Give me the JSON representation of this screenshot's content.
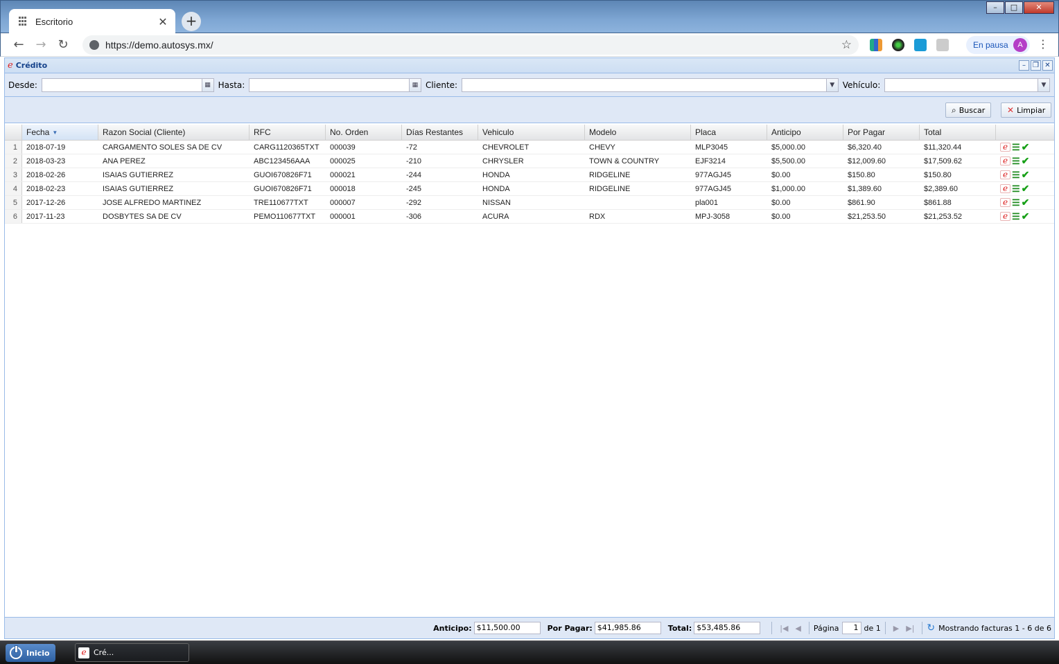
{
  "browser": {
    "tab_title": "Escritorio",
    "new_tab": "+",
    "url": "https://demo.autosys.mx/",
    "profile_status": "En pausa",
    "profile_initial": "A",
    "window_controls": {
      "minimize": "–",
      "maximize": "□",
      "close": "✕"
    }
  },
  "app": {
    "title": "Crédito",
    "logo_glyph": "e",
    "filters": {
      "desde_label": "Desde:",
      "desde_value": "",
      "hasta_label": "Hasta:",
      "hasta_value": "",
      "cliente_label": "Cliente:",
      "cliente_value": "",
      "vehiculo_label": "Vehículo:",
      "vehiculo_value": ""
    },
    "buttons": {
      "buscar": "Buscar",
      "limpiar": "Limpiar"
    },
    "grid": {
      "columns": [
        "Fecha",
        "Razon Social (Cliente)",
        "RFC",
        "No. Orden",
        "Días Restantes",
        "Vehiculo",
        "Modelo",
        "Placa",
        "Anticipo",
        "Por Pagar",
        "Total"
      ],
      "sort_indicator": "▼",
      "rows": [
        {
          "n": "1",
          "fecha": "2018-07-19",
          "razon": "CARGAMENTO SOLES SA DE CV",
          "rfc": "CARG1120365TXT",
          "orden": "000039",
          "dias": "-72",
          "vehiculo": "CHEVROLET",
          "modelo": "CHEVY",
          "placa": "MLP3045",
          "anticipo": "$5,000.00",
          "porpagar": "$6,320.40",
          "total": "$11,320.44"
        },
        {
          "n": "2",
          "fecha": "2018-03-23",
          "razon": "ANA PEREZ",
          "rfc": "ABC123456AAA",
          "orden": "000025",
          "dias": "-210",
          "vehiculo": "CHRYSLER",
          "modelo": "TOWN & COUNTRY",
          "placa": "EJF3214",
          "anticipo": "$5,500.00",
          "porpagar": "$12,009.60",
          "total": "$17,509.62"
        },
        {
          "n": "3",
          "fecha": "2018-02-26",
          "razon": "ISAIAS GUTIERREZ",
          "rfc": "GUOI670826F71",
          "orden": "000021",
          "dias": "-244",
          "vehiculo": "HONDA",
          "modelo": "RIDGELINE",
          "placa": "977AGJ45",
          "anticipo": "$0.00",
          "porpagar": "$150.80",
          "total": "$150.80"
        },
        {
          "n": "4",
          "fecha": "2018-02-23",
          "razon": "ISAIAS GUTIERREZ",
          "rfc": "GUOI670826F71",
          "orden": "000018",
          "dias": "-245",
          "vehiculo": "HONDA",
          "modelo": "RIDGELINE",
          "placa": "977AGJ45",
          "anticipo": "$1,000.00",
          "porpagar": "$1,389.60",
          "total": "$2,389.60"
        },
        {
          "n": "5",
          "fecha": "2017-12-26",
          "razon": "JOSE ALFREDO MARTINEZ",
          "rfc": "TRE110677TXT",
          "orden": "000007",
          "dias": "-292",
          "vehiculo": "NISSAN",
          "modelo": "",
          "placa": "pla001",
          "anticipo": "$0.00",
          "porpagar": "$861.90",
          "total": "$861.88"
        },
        {
          "n": "6",
          "fecha": "2017-11-23",
          "razon": "DOSBYTES SA DE CV",
          "rfc": "PEMO110677TXT",
          "orden": "000001",
          "dias": "-306",
          "vehiculo": "ACURA",
          "modelo": "RDX",
          "placa": "MPJ-3058",
          "anticipo": "$0.00",
          "porpagar": "$21,253.50",
          "total": "$21,253.52"
        }
      ]
    },
    "footer": {
      "anticipo_label": "Anticipo:",
      "anticipo_value": "$11,500.00",
      "porpagar_label": "Por Pagar:",
      "porpagar_value": "$41,985.86",
      "total_label": "Total:",
      "total_value": "$53,485.86",
      "pagina_label": "Página",
      "pagina_value": "1",
      "de_label": "de 1",
      "status": "Mostrando facturas 1 - 6 de 6"
    }
  },
  "taskbar": {
    "start_label": "Inicio",
    "task_label": "Cré..."
  },
  "colors": {
    "accent": "#15428b",
    "panel": "#dfe8f6",
    "border": "#99bbe8",
    "action_green": "#18a018",
    "logo_red": "#dd2222"
  }
}
